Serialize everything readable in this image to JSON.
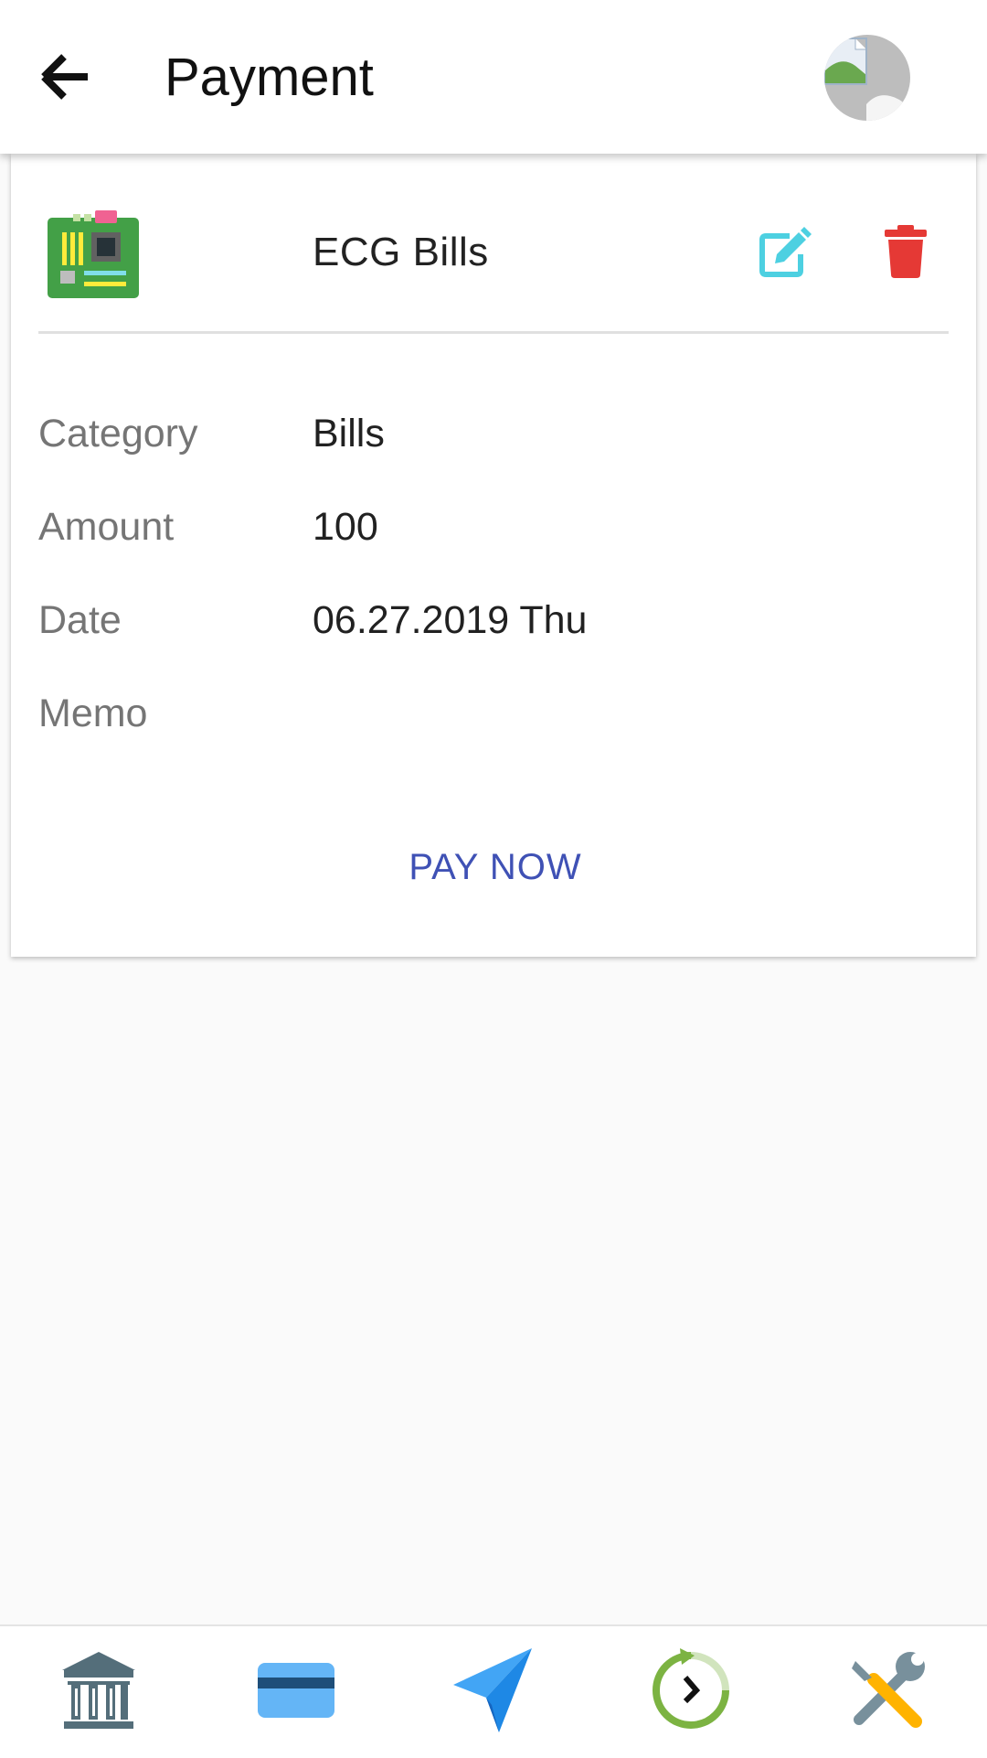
{
  "header": {
    "title": "Payment",
    "back_icon": "arrow-back-icon",
    "avatar_icon": "broken-image-avatar"
  },
  "payment": {
    "name": "ECG Bills",
    "icon": "motherboard-icon",
    "edit_icon": "edit-icon",
    "delete_icon": "trash-icon",
    "details": [
      {
        "label": "Category",
        "value": "Bills"
      },
      {
        "label": "Amount",
        "value": "100"
      },
      {
        "label": "Date",
        "value": "06.27.2019 Thu"
      },
      {
        "label": "Memo",
        "value": ""
      }
    ],
    "pay_button": "PAY NOW"
  },
  "bottom_nav": {
    "items": [
      {
        "icon": "bank-icon"
      },
      {
        "icon": "credit-card-icon"
      },
      {
        "icon": "paper-plane-icon"
      },
      {
        "icon": "history-clock-icon"
      },
      {
        "icon": "tools-icon"
      }
    ]
  },
  "colors": {
    "accent": "#3f51b5",
    "edit": "#4dd0e1",
    "delete": "#e53935",
    "icon_green": "#43a047"
  }
}
